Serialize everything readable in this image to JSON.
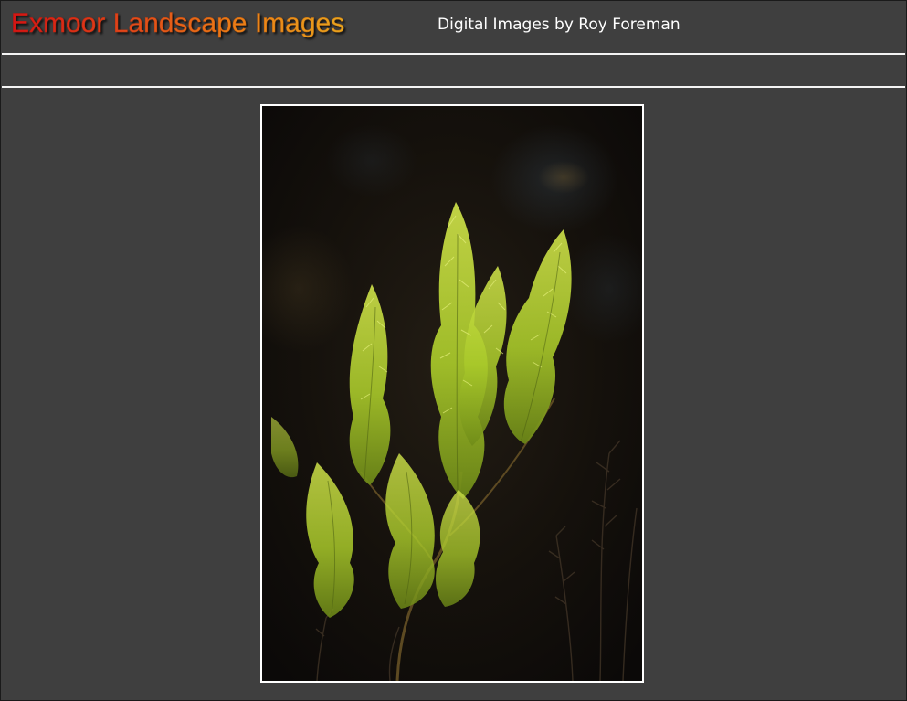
{
  "header": {
    "title": "Exmoor Landscape Images",
    "subtitle": "Digital Images by Roy Foreman"
  },
  "photo": {
    "subject": "heather-sprig-photo",
    "border_color": "#ffffff"
  },
  "colors": {
    "page_background": "#3f3f3f",
    "rule": "#f4f4f4",
    "title_gradient_start": "#d41414",
    "title_gradient_end": "#e8a51e",
    "subtitle": "#ffffff",
    "foliage": "#b8d62a"
  }
}
